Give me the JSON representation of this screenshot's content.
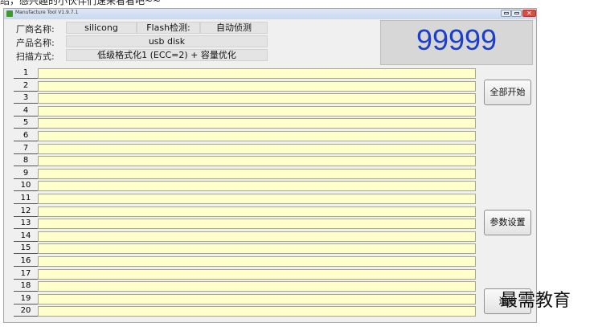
{
  "caption": "绍，感兴趣的小伙伴们速来看看吧~~",
  "window": {
    "title": "Manufacture Tool  V1.9.7.1"
  },
  "info": {
    "vendor_label": "厂商名称:",
    "vendor_value": "silicong",
    "flash_label": "Flash检测:",
    "flash_value": "自动侦测",
    "product_label": "产品名称:",
    "product_value": "usb disk",
    "scan_label": "扫描方式:",
    "scan_value": "低级格式化1 (ECC=2) + 容量优化"
  },
  "counter": "99999",
  "rows": [
    "1",
    "2",
    "3",
    "4",
    "5",
    "6",
    "7",
    "8",
    "9",
    "10",
    "11",
    "12",
    "13",
    "14",
    "15",
    "16",
    "17",
    "18",
    "19",
    "20"
  ],
  "buttons": {
    "start_all": "全部开始",
    "settings": "参数设置",
    "exit": "退出"
  },
  "watermark": "最需教育"
}
